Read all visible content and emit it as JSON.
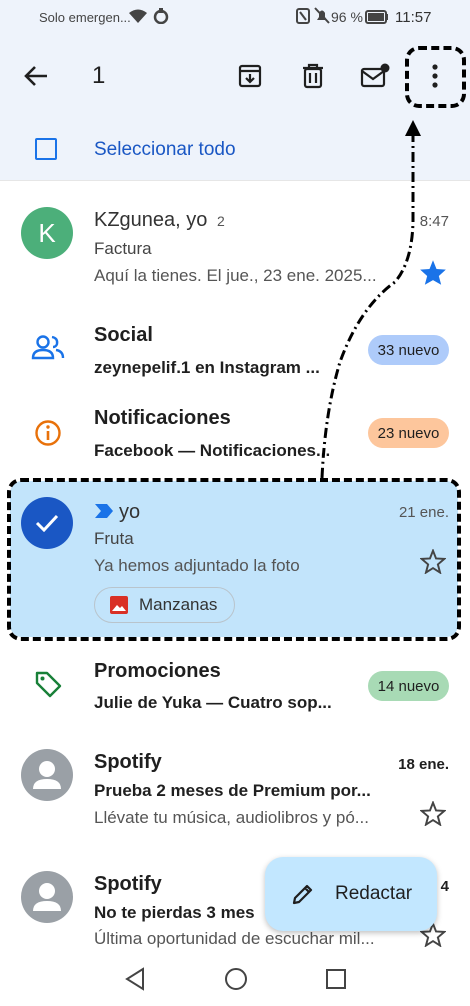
{
  "status_bar": {
    "carrier": "Solo emergen...",
    "battery": "96 %",
    "time": "11:57"
  },
  "toolbar": {
    "selected_count": "1"
  },
  "select_all": {
    "label": "Seleccionar todo"
  },
  "emails": [
    {
      "avatar_letter": "K",
      "sender": "KZgunea, yo",
      "thread_count": "2",
      "time": "8:47",
      "subject": "Factura",
      "snippet": "Aquí la tienes. El jue., 23 ene. 2025...",
      "starred": true
    },
    {
      "sender": "Social",
      "subject": "zeynepelif.1 en Instagram ...",
      "badge": "33 nuevo",
      "badge_color": "#aecbfa"
    },
    {
      "sender": "Notificaciones",
      "subject": "Facebook — Notificaciones...",
      "badge": "23 nuevo",
      "badge_color": "#fdc69c"
    },
    {
      "sender": "yo",
      "time": "21 ene.",
      "subject": "Fruta",
      "snippet": "Ya hemos adjuntado la foto",
      "attachment": "Manzanas",
      "selected": true
    },
    {
      "sender": "Promociones",
      "subject": "Julie de Yuka — Cuatro sop...",
      "badge": "14 nuevo",
      "badge_color": "#a8dab5"
    },
    {
      "sender": "Spotify",
      "time": "18 ene.",
      "subject": "Prueba 2 meses de Premium por...",
      "snippet": "Llévate tu música, audiolibros y pó..."
    },
    {
      "sender": "Spotify",
      "time": "4",
      "subject": "No te pierdas 3 mes",
      "snippet": "Última oportunidad de escuchar mil..."
    }
  ],
  "fab": {
    "label": "Redactar"
  },
  "colors": {
    "header_bg": "#eef3fb",
    "selected_bg": "#c2e4fb",
    "accent_blue": "#1a57c4",
    "avatar_green": "#4caf7a",
    "check_blue": "#1a57c4",
    "star_blue": "#1a73e8"
  }
}
